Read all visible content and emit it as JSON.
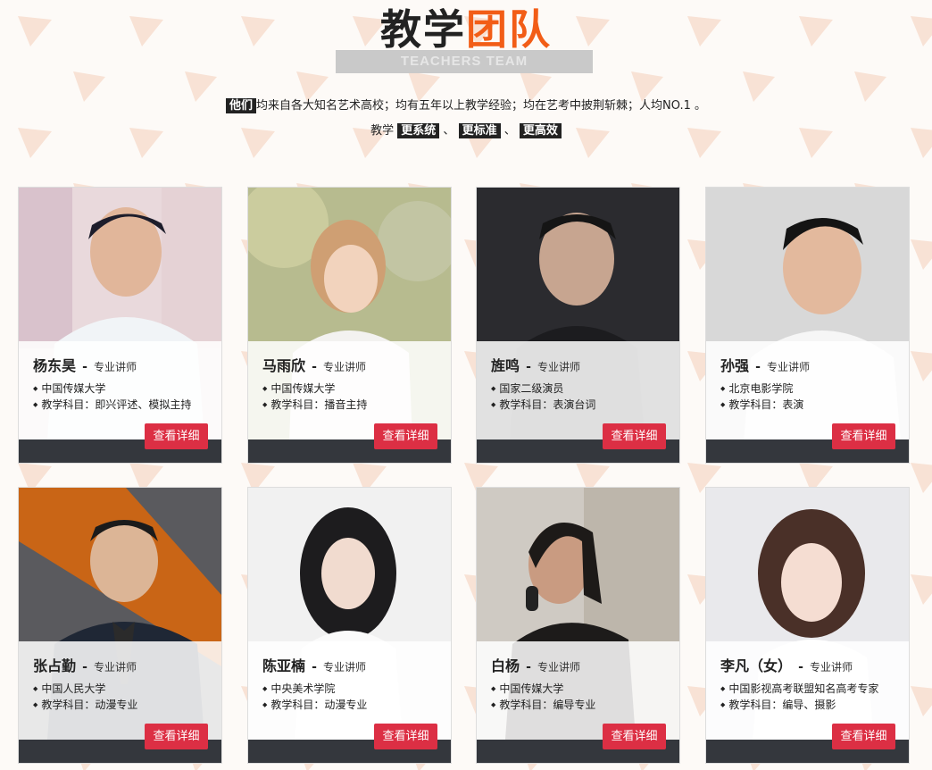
{
  "header": {
    "title_part1": "教学",
    "title_part2": "团队",
    "subtitle": "TEACHERS TEAM"
  },
  "intro": {
    "highlight": "他们",
    "text": "均来自各大知名艺术高校；均有五年以上教学经验；均在艺考中披荆斩棘；人均NO.1 。",
    "prefix": "教学",
    "tags": [
      "更系统",
      "更标准",
      "更高效"
    ],
    "separator": "、"
  },
  "colors": {
    "accent": "#f25d17",
    "button": "#dc2f44",
    "bar": "#34373d"
  },
  "button_label": "查看详细",
  "teachers": [
    {
      "name": "杨东昊",
      "role": "专业讲师",
      "school": "中国传媒大学",
      "subject": "教学科目：即兴评述、模拟主持"
    },
    {
      "name": "马雨欣",
      "role": "专业讲师",
      "school": "中国传媒大学",
      "subject": "教学科目：播音主持"
    },
    {
      "name": "旌鸣",
      "role": "专业讲师",
      "school": "国家二级演员",
      "subject": "教学科目：表演台词"
    },
    {
      "name": "孙强",
      "role": "专业讲师",
      "school": "北京电影学院",
      "subject": "教学科目：表演"
    },
    {
      "name": "张占勤",
      "role": "专业讲师",
      "school": "中国人民大学",
      "subject": "教学科目：动漫专业"
    },
    {
      "name": "陈亚楠",
      "role": "专业讲师",
      "school": "中央美术学院",
      "subject": "教学科目：动漫专业"
    },
    {
      "name": "白杨",
      "role": "专业讲师",
      "school": "中国传媒大学",
      "subject": "教学科目：编导专业"
    },
    {
      "name": "李凡（女）",
      "role": "专业讲师",
      "school": "中国影视高考联盟知名高考专家",
      "subject": "教学科目：编导、摄影"
    }
  ]
}
